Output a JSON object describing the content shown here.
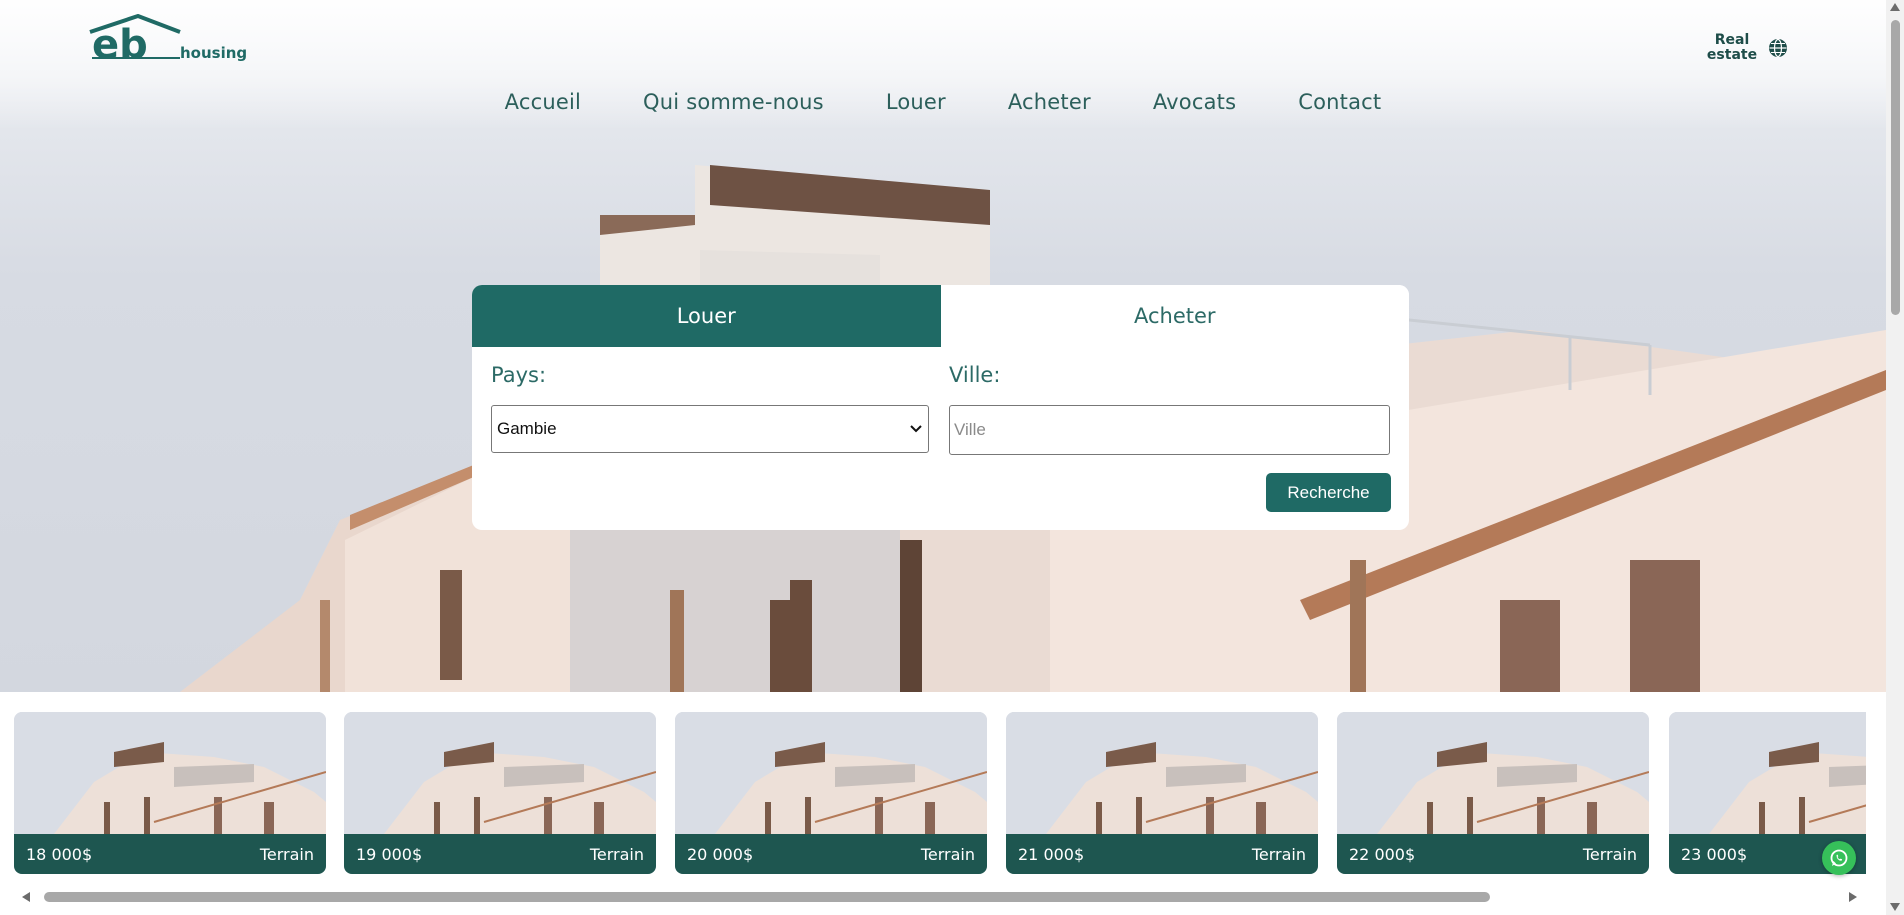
{
  "brand": {
    "logo_mark": "eb",
    "logo_word": "housing"
  },
  "nav": {
    "items": [
      {
        "label": "Accueil"
      },
      {
        "label": "Qui somme-nous"
      },
      {
        "label": "Louer"
      },
      {
        "label": "Acheter"
      },
      {
        "label": "Avocats"
      },
      {
        "label": "Contact"
      }
    ]
  },
  "language": {
    "label_line1": "Real",
    "label_line2": "estate",
    "icon": "globe-icon"
  },
  "search": {
    "tabs": [
      {
        "label": "Louer",
        "active": true
      },
      {
        "label": "Acheter",
        "active": false
      }
    ],
    "country_label": "Pays:",
    "country_value": "Gambie",
    "city_label": "Ville:",
    "city_placeholder": "Ville",
    "city_value": "",
    "button_label": "Recherche"
  },
  "listings": [
    {
      "price": "18 000$",
      "type": "Terrain"
    },
    {
      "price": "19 000$",
      "type": "Terrain"
    },
    {
      "price": "20 000$",
      "type": "Terrain"
    },
    {
      "price": "21 000$",
      "type": "Terrain"
    },
    {
      "price": "22 000$",
      "type": "Terrain"
    },
    {
      "price": "23 000$",
      "type": ""
    }
  ],
  "floating": {
    "icon": "whatsapp-icon"
  },
  "colors": {
    "brand": "#1f6a65",
    "brand_dark": "#1e5650",
    "nav_text": "#2c5f5b",
    "whatsapp": "#36c05a"
  }
}
